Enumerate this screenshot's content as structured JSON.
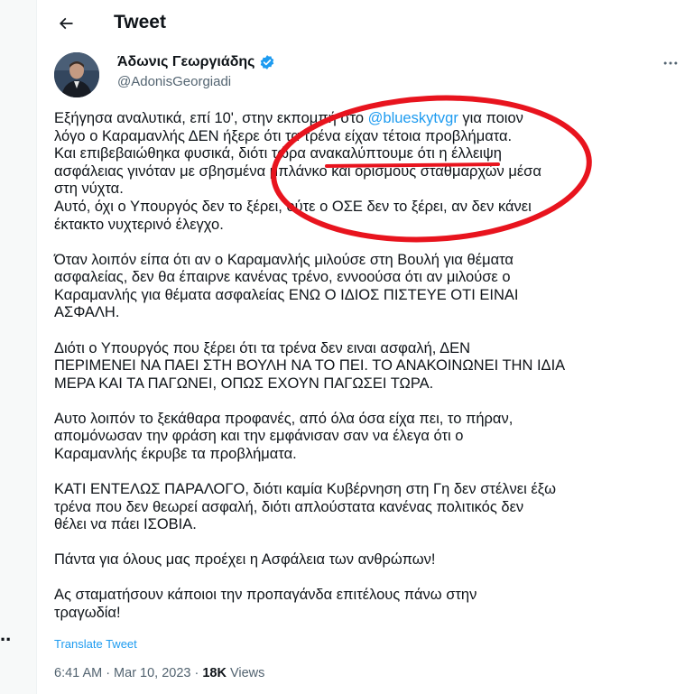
{
  "header": {
    "title": "Tweet"
  },
  "author": {
    "name": "Άδωνις Γεωργιάδης",
    "handle": "@AdonisGeorgiadi"
  },
  "tweet": {
    "p1_before_mention": "Εξήγησα αναλυτικά, επί 10', στην εκπομπή στο ",
    "p1_mention": "@blueskytvgr",
    "p1_after_mention": " για ποιον\nλόγο ο Καραμανλής ΔΕΝ ήξερε ότι τα τρένα είχαν τέτοια προβλήματα.\nΚαι επιβεβαιώθηκα φυσικά, διότι τώρα ανακαλύπτουμε ότι η έλλειψη\nασφάλειας γινόταν με σβησμένα μπλάνκο και ορισμούς σταθμαρχών μέσα\nστη νύχτα.\nΑυτό, όχι ο Υπουργός δεν το ξέρει, ούτε ο ΟΣΕ δεν το ξέρει, αν δεν κάνει\nέκτακτο νυχτερινό έλεγχο.",
    "p2": "Όταν λοιπόν είπα ότι αν ο Καραμανλής μιλούσε στη Βουλή για θέματα\nασφαλείας, δεν θα έπαιρνε κανένας τρένο, εννοούσα ότι αν μιλούσε ο\nΚαραμανλής για θέματα ασφαλείας ΕΝΩ Ο ΙΔΙΟΣ ΠΙΣΤΕΥΕ ΟΤΙ ΕΙΝΑΙ\nΑΣΦΑΛΗ.",
    "p3": "Διότι ο Υπουργός που ξέρει ότι τα τρένα δεν ειναι ασφαλή, ΔΕΝ\nΠΕΡΙΜΕΝΕΙ ΝΑ ΠΑΕΙ ΣΤΗ ΒΟΥΛΗ ΝΑ ΤΟ ΠΕΙ. ΤΟ ΑΝΑΚΟΙΝΩΝΕΙ ΤΗΝ ΙΔΙΑ\nΜΕΡΑ ΚΑΙ ΤΑ ΠΑΓΩΝΕΙ, ΟΠΩΣ ΕΧΟΥΝ ΠΑΓΩΣΕΙ ΤΩΡΑ.",
    "p4": "Αυτο λοιπόν το ξεκάθαρα προφανές, από όλα όσα είχα πει, το πήραν,\nαπομόνωσαν την φράση και την εμφάνισαν σαν να έλεγα ότι ο\nΚαραμανλής έκρυβε τα προβλήματα.",
    "p5": "ΚΑΤΙ ΕΝΤΕΛΩΣ ΠΑΡΑΛΟΓΟ, διότι καμία Κυβέρνηση στη Γη δεν στέλνει έξω\nτρένα που δεν θεωρεί ασφαλή, διότι απλούστατα κανένας πολιτικός δεν\nθέλει να πάει ΙΣΟΒΙΑ.",
    "p6": "Πάντα για όλους μας προέχει η Ασφάλεια των ανθρώπων!",
    "p7": "Ας σταματήσουν κάποιοι την προπαγάνδα επιτέλους πάνω στην\nτραγωδία!"
  },
  "translate_label": "Translate Tweet",
  "meta": {
    "time": "6:41 AM",
    "separator": "·",
    "date": "Mar 10, 2023",
    "views_count": "18K",
    "views_label": "Views"
  },
  "left_overflow_text": "..",
  "colors": {
    "accent": "#1d9bf0",
    "annotation_red": "#e8141e",
    "text": "#0f1419",
    "secondary": "#536471"
  },
  "icons": [
    "back-arrow-icon",
    "verified-badge-icon",
    "more-options-icon"
  ]
}
